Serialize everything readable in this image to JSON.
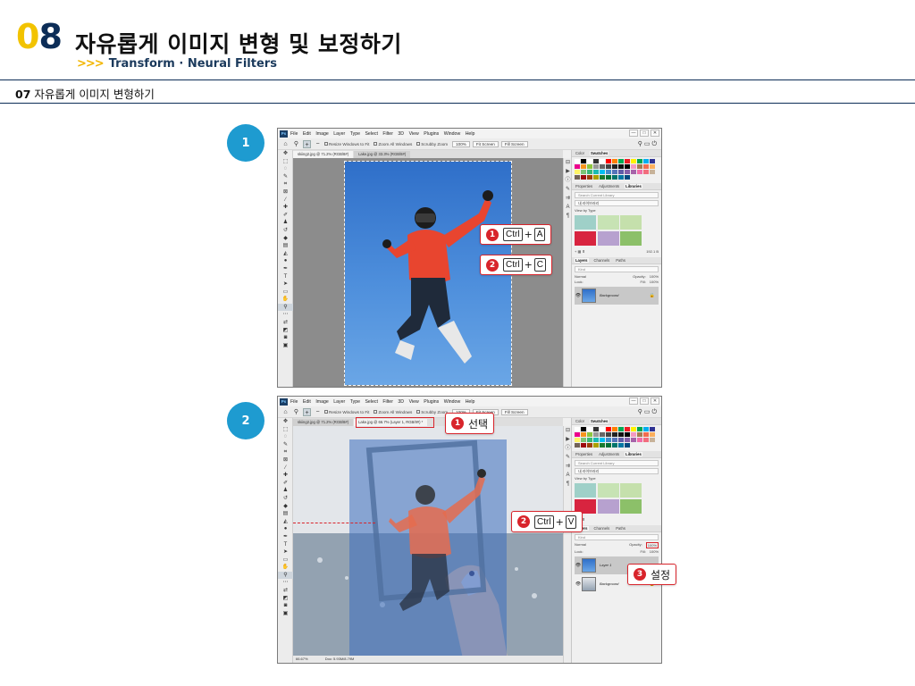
{
  "header": {
    "chapter_num_first": "0",
    "chapter_num_second": "8",
    "title": "자유롭게 이미지 변형 및 보정하기",
    "subtitle_arrows": ">>>",
    "subtitle": "Transform · Neural Filters"
  },
  "section": {
    "number": "07",
    "title": "자유롭게 이미지 변형하기"
  },
  "steps": [
    {
      "label": "1"
    },
    {
      "label": "2"
    }
  ],
  "photoshop": {
    "logo": "Ps",
    "menu": [
      "File",
      "Edit",
      "Image",
      "Layer",
      "Type",
      "Select",
      "Filter",
      "3D",
      "View",
      "Plugins",
      "Window",
      "Help"
    ],
    "window_controls": [
      "—",
      "□",
      "✕"
    ],
    "options": {
      "resize_windows": "Resize Windows to Fit",
      "zoom_all": "Zoom All Windows",
      "scrubby_zoom": "Scrubby Zoom",
      "zoom_value": "100%",
      "fit_screen": "Fit Screen",
      "fill_screen": "Fill Screen"
    },
    "panels": {
      "color_tabs": [
        "Color",
        "Swatches"
      ],
      "lib_tabs": [
        "Properties",
        "Adjustments",
        "Libraries"
      ],
      "search_placeholder": "Search Current Library",
      "library_name": "내 라이브러리",
      "view_by": "View by Type",
      "size_readout": "192.1 B",
      "layer_tabs": [
        "Layers",
        "Channels",
        "Paths"
      ],
      "kind": "Kind",
      "blend": "Normal",
      "opacity_label": "Opacity:",
      "opacity_value": "100%",
      "lock_label": "Lock:",
      "fill_label": "Fill:",
      "fill_value": "100%"
    },
    "window1": {
      "tabs": [
        "skiing2.jpg @ 71.2% (RGB/8#)",
        "Lake.jpg @ 33.3% (RGB/8#)"
      ],
      "layers": [
        "Background"
      ]
    },
    "window2": {
      "tabs": [
        "skiing2.jpg @ 71.2% (RGB/8#)",
        "Lake.jpg @ 66.7% (Layer 1, RGB/8#) *"
      ],
      "layers": [
        "Layer 1",
        "Background"
      ],
      "status_zoom": "66.67%",
      "status_doc": "Doc: 5.93M/8.79M"
    }
  },
  "callouts": {
    "ctrl_a": {
      "badge": "1",
      "key1": "Ctrl",
      "plus": "+",
      "key2": "A"
    },
    "ctrl_c": {
      "badge": "2",
      "key1": "Ctrl",
      "plus": "+",
      "key2": "C"
    },
    "select_tab": {
      "badge": "1",
      "text": "선택"
    },
    "ctrl_v": {
      "badge": "2",
      "key1": "Ctrl",
      "plus": "+",
      "key2": "V"
    },
    "setting": {
      "badge": "3",
      "text": "설정"
    }
  },
  "colors": {
    "accent_yellow": "#f2c300",
    "navy": "#0c2d57",
    "step_blue": "#1e9bd0",
    "callout_red": "#d8242b"
  }
}
